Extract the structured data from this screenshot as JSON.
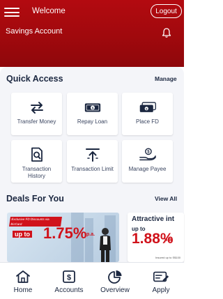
{
  "header": {
    "greeting": "Welcome",
    "logout_label": "Logout",
    "account_label": "Savings Account",
    "menu_icon": "hamburger-menu-icon",
    "bell_icon": "bell-icon"
  },
  "quick_access": {
    "title": "Quick Access",
    "manage_label": "Manage",
    "items": [
      {
        "label": "Transfer Money",
        "icon": "transfer-arrows-icon"
      },
      {
        "label": "Repay Loan",
        "icon": "cash-note-icon"
      },
      {
        "label": "Place FD",
        "icon": "cash-stack-icon"
      },
      {
        "label": "Transaction History",
        "icon": "document-search-icon"
      },
      {
        "label": "Transaction Limit",
        "icon": "limit-arrow-icon"
      },
      {
        "label": "Manage Payee",
        "icon": "hand-money-icon"
      }
    ]
  },
  "deals": {
    "title": "Deals For You",
    "view_all_label": "View All",
    "cards": [
      {
        "tag": "Exclusive FD Discounts via BizCard",
        "prefix": "up to",
        "rate": "1.75%",
        "suffix": "p.a."
      },
      {
        "title": "Attractive int",
        "prefix": "up to",
        "rate": "1.88%",
        "suffix": "p.a.",
        "fine_print": "Insured up to S$100"
      }
    ]
  },
  "bottom_nav": {
    "items": [
      {
        "label": "Home",
        "icon": "home-icon"
      },
      {
        "label": "Accounts",
        "icon": "dollar-wallet-icon"
      },
      {
        "label": "Overview",
        "icon": "pie-chart-icon"
      },
      {
        "label": "Apply",
        "icon": "apply-card-icon"
      }
    ]
  },
  "colors": {
    "brand_red": "#b30a10",
    "accent_red": "#d0121b",
    "navy": "#1b2740"
  }
}
